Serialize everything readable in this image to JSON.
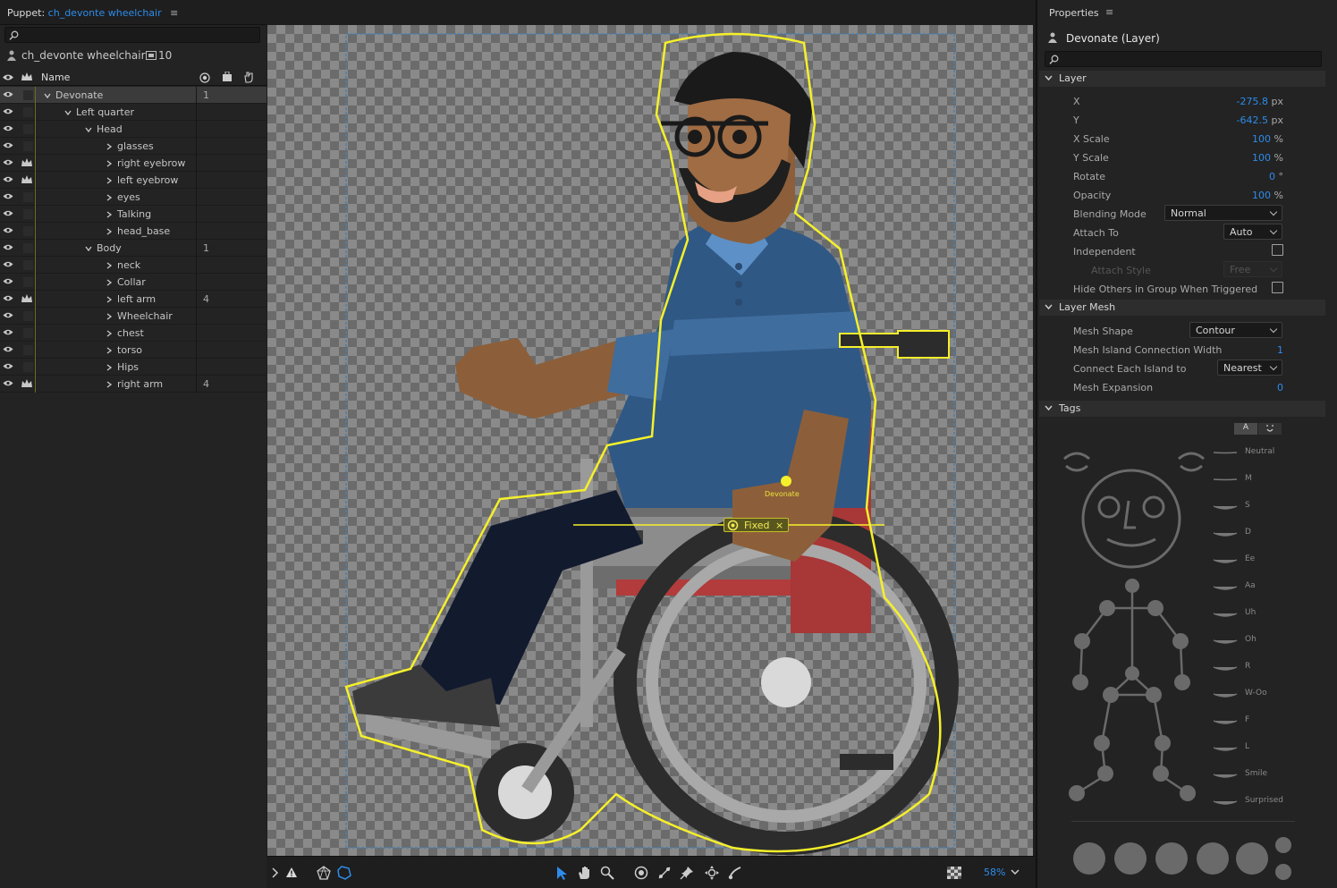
{
  "left_panel": {
    "title_prefix": "Puppet:",
    "title_link": "ch_devonte wheelchair",
    "puppet_name": "ch_devonte wheelchair",
    "layer_count": "10",
    "column_name": "Name",
    "rows": [
      {
        "name": "Devonate",
        "indent": 0,
        "expanded": true,
        "count": "1",
        "crown": false,
        "selected": true
      },
      {
        "name": "Left quarter",
        "indent": 1,
        "expanded": true,
        "count": "",
        "crown": false
      },
      {
        "name": "Head",
        "indent": 2,
        "expanded": true,
        "count": "",
        "crown": false
      },
      {
        "name": "glasses",
        "indent": 3,
        "expanded": false,
        "count": "",
        "crown": false
      },
      {
        "name": "right eyebrow",
        "indent": 3,
        "expanded": false,
        "count": "",
        "crown": true
      },
      {
        "name": "left eyebrow",
        "indent": 3,
        "expanded": false,
        "count": "",
        "crown": true
      },
      {
        "name": "eyes",
        "indent": 3,
        "expanded": false,
        "count": "",
        "crown": false
      },
      {
        "name": "Talking",
        "indent": 3,
        "expanded": false,
        "count": "",
        "crown": false
      },
      {
        "name": "head_base",
        "indent": 3,
        "expanded": false,
        "count": "",
        "crown": false
      },
      {
        "name": "Body",
        "indent": 2,
        "expanded": true,
        "count": "1",
        "crown": false
      },
      {
        "name": "neck",
        "indent": 3,
        "expanded": false,
        "count": "",
        "crown": false
      },
      {
        "name": "Collar",
        "indent": 3,
        "expanded": false,
        "count": "",
        "crown": false
      },
      {
        "name": "left arm",
        "indent": 3,
        "expanded": false,
        "count": "4",
        "crown": true
      },
      {
        "name": "Wheelchair",
        "indent": 3,
        "expanded": false,
        "count": "",
        "crown": false
      },
      {
        "name": "chest",
        "indent": 3,
        "expanded": false,
        "count": "",
        "crown": false
      },
      {
        "name": "torso",
        "indent": 3,
        "expanded": false,
        "count": "",
        "crown": false
      },
      {
        "name": "Hips",
        "indent": 3,
        "expanded": false,
        "count": "",
        "crown": false
      },
      {
        "name": "right arm",
        "indent": 3,
        "expanded": false,
        "count": "4",
        "crown": true
      }
    ]
  },
  "canvas": {
    "handle_label": "Devonate",
    "fixed_label": "Fixed",
    "zoom": "58%"
  },
  "properties": {
    "title": "Properties",
    "layer_title": "Devonate (Layer)",
    "section_layer": "Layer",
    "x_label": "X",
    "x_value": "-275.8",
    "x_unit": "px",
    "y_label": "Y",
    "y_value": "-642.5",
    "y_unit": "px",
    "xscale_label": "X Scale",
    "xscale_value": "100",
    "xscale_unit": "%",
    "yscale_label": "Y Scale",
    "yscale_value": "100",
    "yscale_unit": "%",
    "rotate_label": "Rotate",
    "rotate_value": "0",
    "rotate_unit": "°",
    "opacity_label": "Opacity",
    "opacity_value": "100",
    "opacity_unit": "%",
    "blending_label": "Blending Mode",
    "blending_value": "Normal",
    "attach_label": "Attach To",
    "attach_value": "Auto",
    "independent_label": "Independent",
    "attach_style_label": "Attach Style",
    "attach_style_value": "Free",
    "hide_others_label": "Hide Others in Group When Triggered",
    "section_mesh": "Layer Mesh",
    "mesh_shape_label": "Mesh Shape",
    "mesh_shape_value": "Contour",
    "island_width_label": "Mesh Island Connection Width",
    "island_width_value": "1",
    "connect_label": "Connect Each Island to",
    "connect_value": "Nearest",
    "expansion_label": "Mesh Expansion",
    "expansion_value": "0",
    "section_tags": "Tags",
    "tag_mode": "A",
    "visemes": [
      "Neutral",
      "M",
      "S",
      "D",
      "Ee",
      "Aa",
      "Uh",
      "Oh",
      "R",
      "W-Oo",
      "F",
      "L",
      "Smile",
      "Surprised"
    ]
  },
  "colors": {
    "accent": "#2d8ceb",
    "selection_outline": "#f5f02a",
    "panel": "#232323"
  }
}
